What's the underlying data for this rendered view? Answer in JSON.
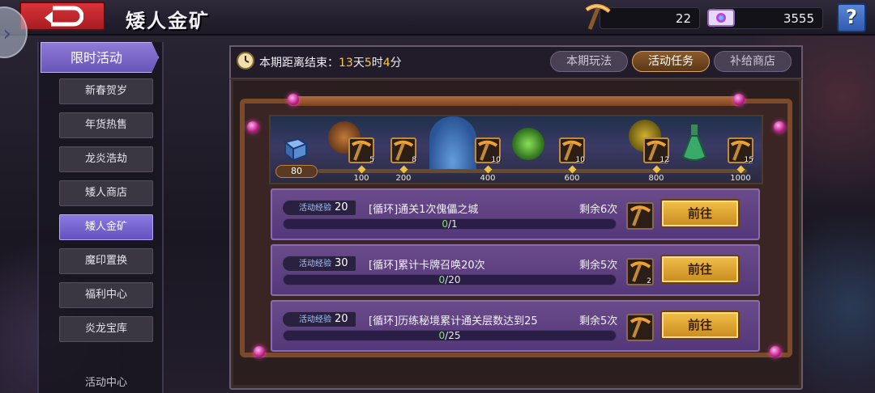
{
  "header": {
    "title": "矮人金矿",
    "pickaxe_count": "22",
    "gem_count": "3555",
    "help_label": "?"
  },
  "nav": {
    "header_label": "限时活动",
    "items": [
      {
        "label": "新春贺岁",
        "active": false
      },
      {
        "label": "年货热售",
        "active": false
      },
      {
        "label": "龙炎浩劫",
        "active": false
      },
      {
        "label": "矮人商店",
        "active": false
      },
      {
        "label": "矮人金矿",
        "active": true
      },
      {
        "label": "魔印置换",
        "active": false
      },
      {
        "label": "福利中心",
        "active": false
      },
      {
        "label": "炎龙宝库",
        "active": false
      }
    ],
    "cut_label": "活动中心"
  },
  "countdown": {
    "label": "本期距离结束：",
    "days": "13",
    "days_unit": "天",
    "hours": "5",
    "hours_unit": "时",
    "minutes": "4",
    "minutes_unit": "分"
  },
  "tabs": [
    {
      "label": "本期玩法",
      "active": false
    },
    {
      "label": "活动任务",
      "active": true
    },
    {
      "label": "补给商店",
      "active": false
    }
  ],
  "progress": {
    "current_exp": "80",
    "milestones": [
      {
        "threshold": "100",
        "reward_count": "5"
      },
      {
        "threshold": "200",
        "reward_count": "8"
      },
      {
        "threshold": "400",
        "reward_count": "10"
      },
      {
        "threshold": "600",
        "reward_count": "10"
      },
      {
        "threshold": "800",
        "reward_count": "12"
      },
      {
        "threshold": "1000",
        "reward_count": "15"
      }
    ]
  },
  "tasks": [
    {
      "exp_label": "活动经验",
      "exp_amount": "20",
      "description": "[循环]通关1次傀儡之城",
      "remaining": "剩余6次",
      "progress_current": "0",
      "progress_total": "/1",
      "reward_count": "",
      "button_label": "前往"
    },
    {
      "exp_label": "活动经验",
      "exp_amount": "30",
      "description": "[循环]累计卡牌召唤20次",
      "remaining": "剩余5次",
      "progress_current": "0",
      "progress_total": "/20",
      "reward_count": "2",
      "button_label": "前往"
    },
    {
      "exp_label": "活动经验",
      "exp_amount": "20",
      "description": "[循环]历练秘境累计通关层数达到25",
      "remaining": "剩余5次",
      "progress_current": "0",
      "progress_total": "/25",
      "reward_count": "",
      "button_label": "前往"
    }
  ],
  "colors": {
    "accent_gold": "#f5c84a",
    "active_tab": "#8a5a2a",
    "active_nav": "#8a7ae0",
    "task_bg": "#6a4a8a",
    "progress_current": "#7ae85a"
  }
}
